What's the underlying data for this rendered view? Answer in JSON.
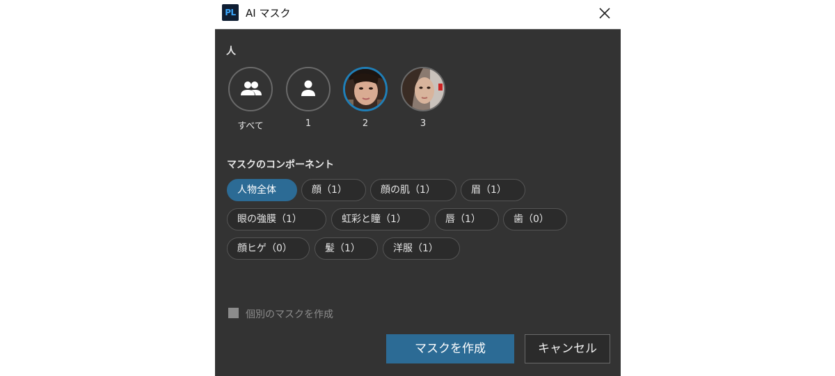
{
  "window": {
    "app_logo": "PL",
    "title": "AI マスク",
    "close_icon": "close-icon"
  },
  "people_section": {
    "label": "人",
    "items": [
      {
        "label": "すべて",
        "icon": "people-group-icon",
        "selected": false
      },
      {
        "label": "1",
        "icon": "person-icon",
        "selected": false
      },
      {
        "label": "2",
        "icon": "face-photo",
        "selected": true
      },
      {
        "label": "3",
        "icon": "face-photo",
        "selected": false
      }
    ]
  },
  "components_section": {
    "label": "マスクのコンポーネント",
    "chips": [
      {
        "label": "人物全体",
        "active": true
      },
      {
        "label": "顔（1）",
        "active": false
      },
      {
        "label": "顔の肌（1）",
        "active": false
      },
      {
        "label": "眉（1）",
        "active": false
      },
      {
        "label": "眼の強膜（1）",
        "active": false
      },
      {
        "label": "虹彩と瞳（1）",
        "active": false
      },
      {
        "label": "唇（1）",
        "active": false
      },
      {
        "label": "歯（0）",
        "active": false
      },
      {
        "label": "顔ヒゲ（0）",
        "active": false
      },
      {
        "label": "髪（1）",
        "active": false
      },
      {
        "label": "洋服（1）",
        "active": false
      }
    ]
  },
  "individual_masks": {
    "label": "個別のマスクを作成",
    "checked": false,
    "enabled": false
  },
  "buttons": {
    "create": "マスクを作成",
    "cancel": "キャンセル"
  },
  "colors": {
    "dialog_bg": "#333333",
    "accent": "#2c6b95",
    "selected_ring": "#1f7fb8",
    "text": "#e6e6e6",
    "disabled_text": "#8c8c8c"
  }
}
